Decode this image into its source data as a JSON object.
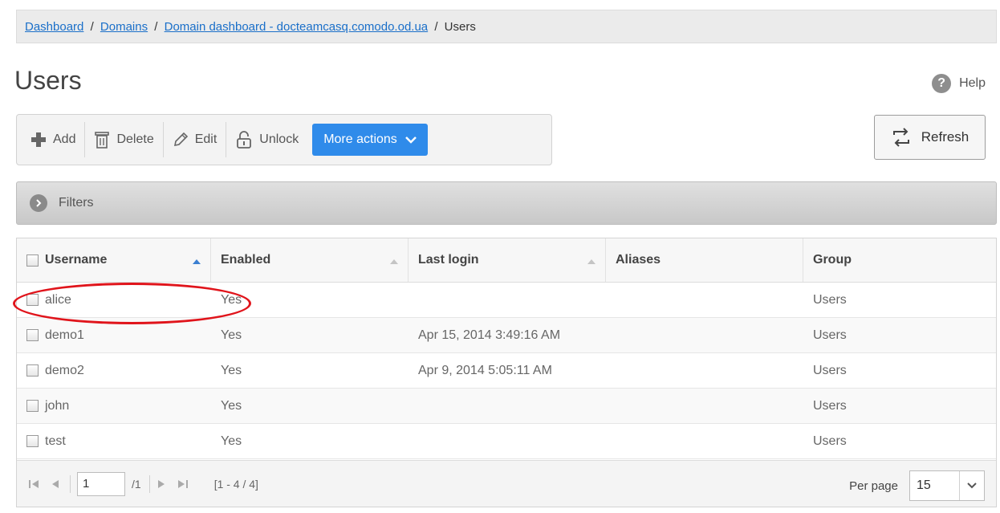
{
  "breadcrumb": {
    "dashboard": "Dashboard",
    "domains": "Domains",
    "domain_dashboard": "Domain dashboard - docteamcasq.comodo.od.ua",
    "current": "Users",
    "separator": "/"
  },
  "page": {
    "title": "Users",
    "help_label": "Help"
  },
  "toolbar": {
    "add": "Add",
    "delete": "Delete",
    "edit": "Edit",
    "unlock": "Unlock",
    "more_actions": "More actions",
    "refresh": "Refresh"
  },
  "filters": {
    "label": "Filters"
  },
  "table": {
    "columns": [
      "Username",
      "Enabled",
      "Last login",
      "Aliases",
      "Group"
    ],
    "rows": [
      {
        "username": "alice",
        "enabled": "Yes",
        "last_login": "",
        "aliases": "",
        "group": "Users"
      },
      {
        "username": "demo1",
        "enabled": "Yes",
        "last_login": "Apr 15, 2014 3:49:16 AM",
        "aliases": "",
        "group": "Users"
      },
      {
        "username": "demo2",
        "enabled": "Yes",
        "last_login": "Apr 9, 2014 5:05:11 AM",
        "aliases": "",
        "group": "Users"
      },
      {
        "username": "john",
        "enabled": "Yes",
        "last_login": "",
        "aliases": "",
        "group": "Users"
      },
      {
        "username": "test",
        "enabled": "Yes",
        "last_login": "",
        "aliases": "",
        "group": "Users"
      }
    ]
  },
  "pagination": {
    "page": "1",
    "total": "/1",
    "range": "[1 - 4 / 4]",
    "per_page_label": "Per page",
    "per_page_value": "15"
  },
  "colors": {
    "accent": "#2f8bea",
    "annotation": "#e0141b"
  }
}
